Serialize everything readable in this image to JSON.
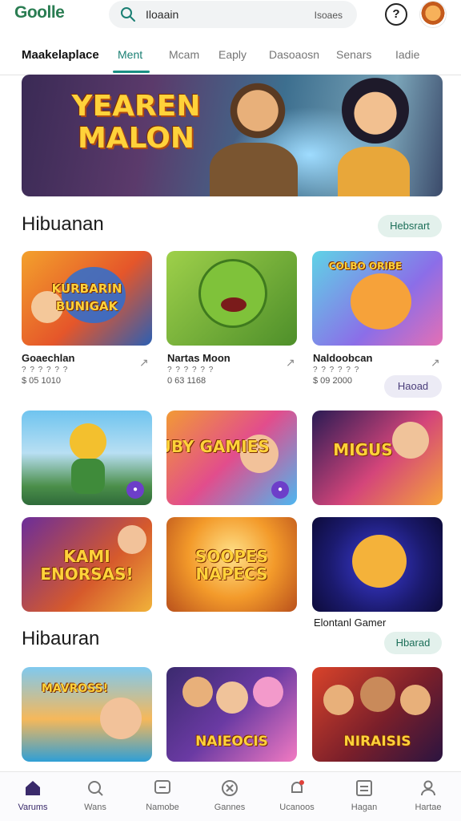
{
  "header": {
    "logo": "Goolle",
    "search": {
      "value": "Iloaain",
      "placeholder": "Isoaes"
    },
    "help_symbol": "?",
    "avatar_icon": "bear-avatar"
  },
  "tabs": [
    {
      "label": "Maakelaplace"
    },
    {
      "label": "Ment"
    },
    {
      "label": "Mcam"
    },
    {
      "label": "Eaply"
    },
    {
      "label": "Dasoaosn"
    },
    {
      "label": "Senars"
    },
    {
      "label": "Iadie"
    }
  ],
  "banner": {
    "title": "YEAREN MALON"
  },
  "sections": [
    {
      "title": "Hibuanan",
      "action": "Hebsrart"
    },
    {
      "title": "Hibauran",
      "action": "Hbarad"
    }
  ],
  "featured_games": [
    {
      "name": "Goaechlan",
      "sub": "? ? ? ? ? ?",
      "meta": "$ 05 1010",
      "art_text": "KURBARIN BUNIGAK"
    },
    {
      "name": "Nartas Moon",
      "sub": "? ? ? ? ? ?",
      "meta": "0 63 1168",
      "art_text": ""
    },
    {
      "name": "Naldoobcan",
      "sub": "? ? ? ? ? ?",
      "meta": "$ 09 2000",
      "art_text": "COLBO ORIBE"
    }
  ],
  "row_action": "Haoad",
  "row2_cards": [
    {
      "art_text": ""
    },
    {
      "art_text": "RUBY GAMIES"
    },
    {
      "art_text": "MIGUS"
    }
  ],
  "row3_cards": [
    {
      "art_text": "KAMI ENORSAS!"
    },
    {
      "art_text": "SOOPES NAPECS"
    },
    {
      "art_text": ""
    }
  ],
  "row3_caption": "Elontanl Gamer",
  "row4_cards": [
    {
      "art_text": "MAVROSS!"
    },
    {
      "art_text": "NAIEOCIS"
    },
    {
      "art_text": "NIRAISIS"
    }
  ],
  "bottom_nav": [
    {
      "label": "Varums",
      "icon": "home-icon"
    },
    {
      "label": "Wans",
      "icon": "search-icon"
    },
    {
      "label": "Namobe",
      "icon": "chat-icon"
    },
    {
      "label": "Gannes",
      "icon": "gamepad-icon"
    },
    {
      "label": "Ucanoos",
      "icon": "notification-icon"
    },
    {
      "label": "Hagan",
      "icon": "list-icon"
    },
    {
      "label": "Hartae",
      "icon": "profile-icon"
    }
  ],
  "colors": {
    "accent": "#1a8f83",
    "nav_active": "#3a2a6b",
    "pill_green": "#e3f1ec",
    "pill_purple": "#ecebf5"
  }
}
